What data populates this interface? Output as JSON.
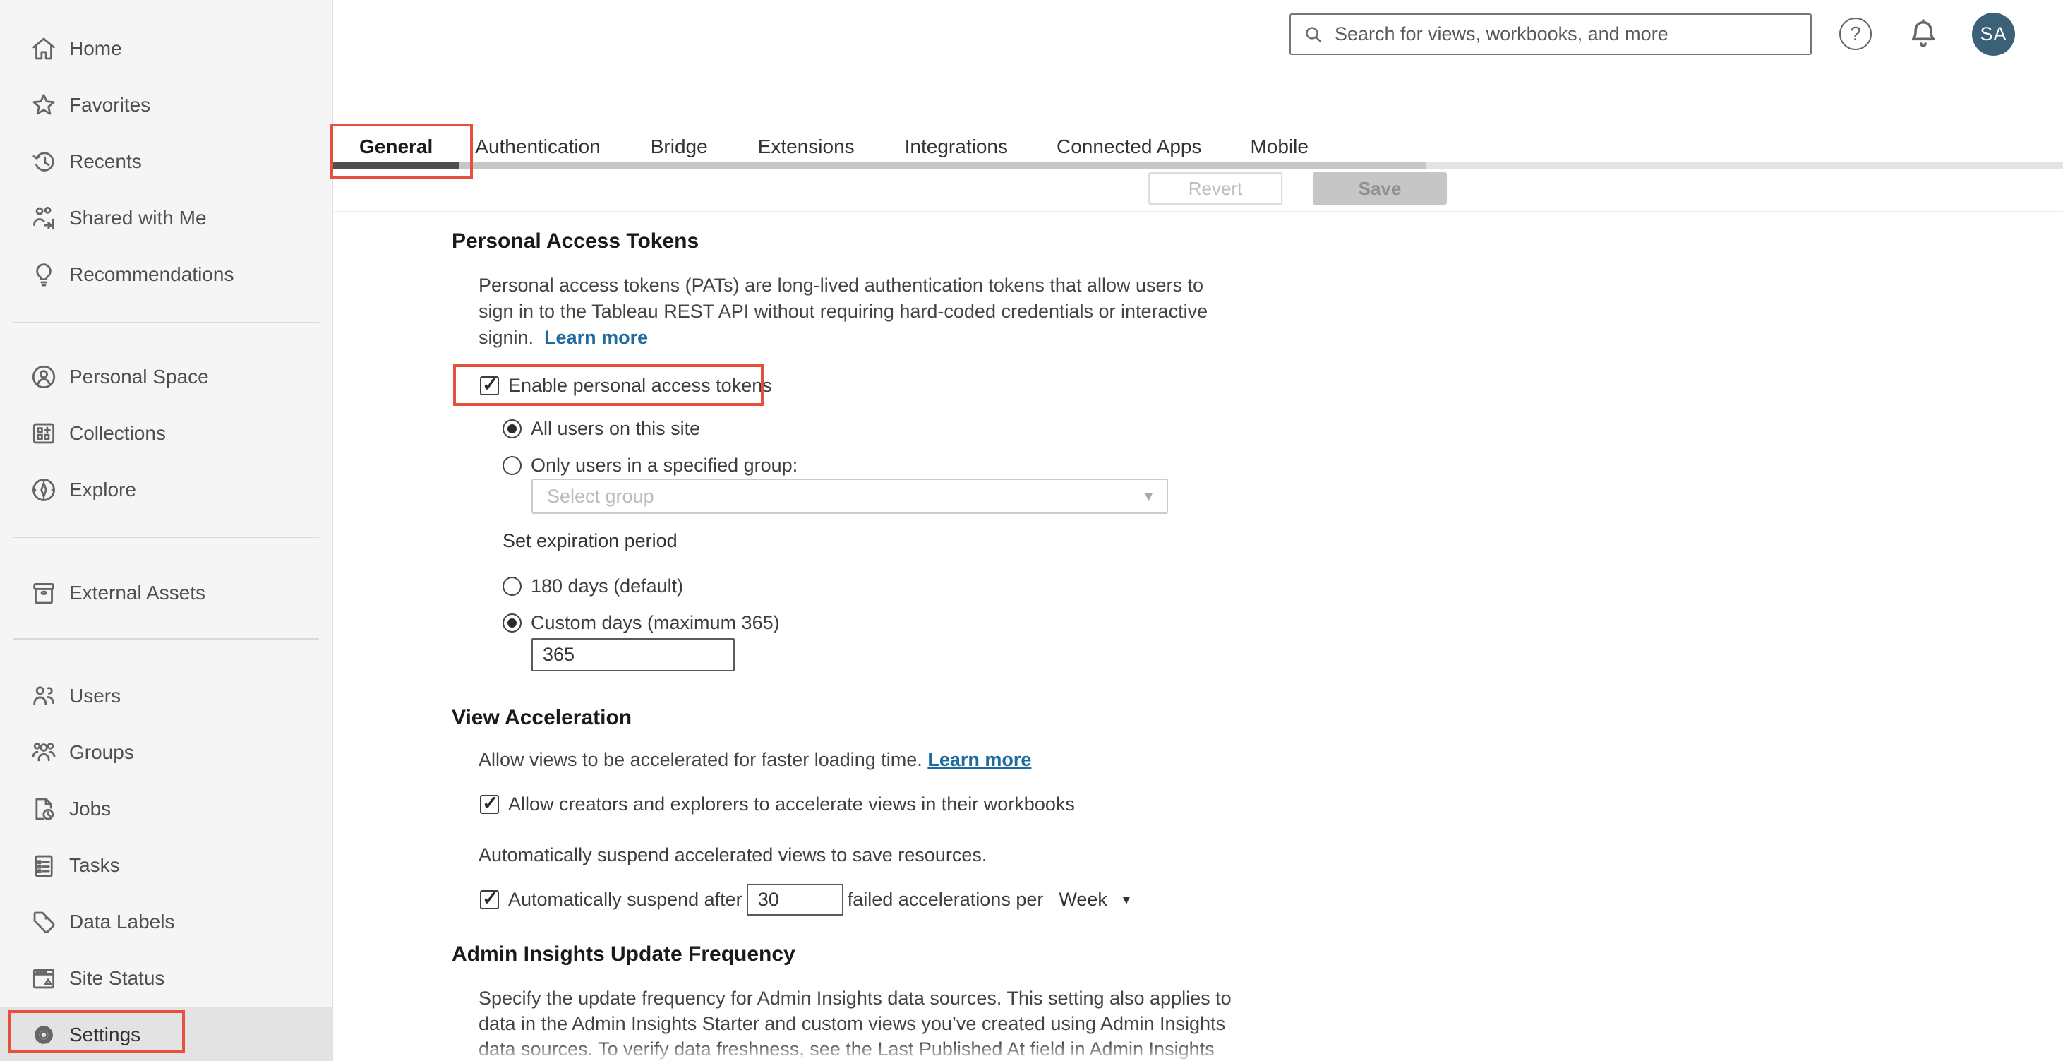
{
  "topbar": {
    "search_placeholder": "Search for views, workbooks, and more",
    "help_glyph": "?",
    "avatar_initials": "SA"
  },
  "sidebar": {
    "items": [
      {
        "icon": "home-icon",
        "label": "Home"
      },
      {
        "icon": "star-icon",
        "label": "Favorites"
      },
      {
        "icon": "history-icon",
        "label": "Recents"
      },
      {
        "icon": "shared-icon",
        "label": "Shared with Me"
      },
      {
        "icon": "lightbulb-icon",
        "label": "Recommendations"
      },
      {
        "icon": "person-circle-icon",
        "label": "Personal Space"
      },
      {
        "icon": "collections-icon",
        "label": "Collections"
      },
      {
        "icon": "compass-icon",
        "label": "Explore"
      },
      {
        "icon": "drawer-icon",
        "label": "External Assets"
      },
      {
        "icon": "users-icon",
        "label": "Users"
      },
      {
        "icon": "groups-icon",
        "label": "Groups"
      },
      {
        "icon": "jobs-icon",
        "label": "Jobs"
      },
      {
        "icon": "tasks-icon",
        "label": "Tasks"
      },
      {
        "icon": "tag-icon",
        "label": "Data Labels"
      },
      {
        "icon": "site-status-icon",
        "label": "Site Status"
      },
      {
        "icon": "gear-icon",
        "label": "Settings",
        "selected": true
      }
    ]
  },
  "tabs": {
    "items": [
      {
        "label": "General",
        "active": true
      },
      {
        "label": "Authentication"
      },
      {
        "label": "Bridge"
      },
      {
        "label": "Extensions"
      },
      {
        "label": "Integrations"
      },
      {
        "label": "Connected Apps"
      },
      {
        "label": "Mobile"
      }
    ]
  },
  "actions": {
    "revert": "Revert",
    "save": "Save"
  },
  "sections": {
    "pat": {
      "title": "Personal Access Tokens",
      "desc_line1": "Personal access tokens (PATs) are long-lived authentication tokens that allow users to",
      "desc_line2": "sign in to the Tableau REST API without requiring hard-coded credentials or interactive",
      "desc_line3": "signin.",
      "learn_more": "Learn more",
      "enable_label": "Enable personal access tokens",
      "enable_checked": true,
      "radio_all_users": "All users on this site",
      "radio_all_users_checked": true,
      "radio_group": "Only users in a specified group:",
      "group_placeholder": "Select group",
      "expiration_label": "Set expiration period",
      "radio_180": "180 days (default)",
      "radio_custom": "Custom days (maximum 365)",
      "radio_custom_checked": true,
      "custom_days_value": "365"
    },
    "view_acceleration": {
      "title": "View Acceleration",
      "description": "Allow views to be accelerated for faster loading time.",
      "learn_more": "Learn more",
      "allow_label": "Allow creators and explorers to accelerate views in their workbooks",
      "allow_checked": true,
      "suspend_note": "Automatically suspend accelerated views to save resources.",
      "suspend_prefix": "Automatically suspend after",
      "suspend_value": "30",
      "suspend_checked": true,
      "suspend_suffix": "failed accelerations per",
      "suspend_period": "Week"
    },
    "admin_insights": {
      "title": "Admin Insights Update Frequency",
      "desc_line1": "Specify the update frequency for Admin Insights data sources. This setting also applies to",
      "desc_line2": "data in the Admin Insights Starter and custom views you’ve created using Admin Insights",
      "desc_line3": "data sources. To verify data freshness, see the Last Published At field in Admin Insights"
    }
  },
  "colors": {
    "annotation_red": "#e8503b",
    "link_blue": "#1f6a9e",
    "avatar_bg": "#3a6178",
    "sidebar_bg": "#f5f5f5"
  }
}
